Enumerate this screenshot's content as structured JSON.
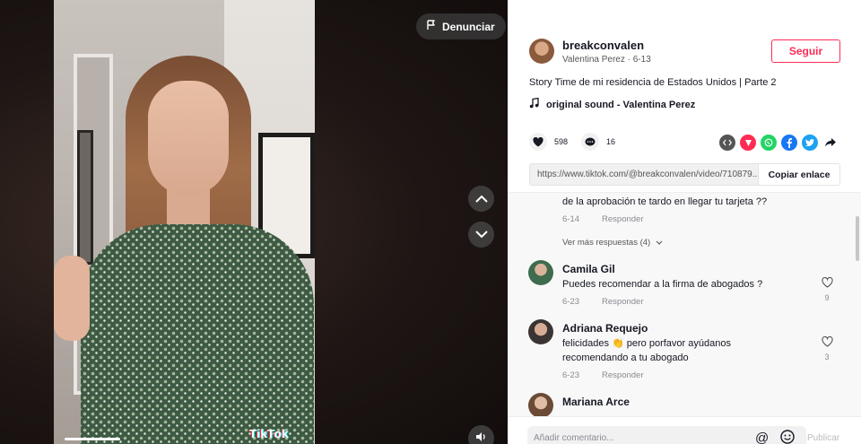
{
  "video": {
    "report_label": "Denunciar",
    "watermark": "TikTok"
  },
  "post": {
    "username": "breakconvalen",
    "display_name": "Valentina Perez",
    "date": "6-13",
    "separator": " · ",
    "follow_label": "Seguir",
    "description": "Story Time de mi residencia de Estados Unidos | Parte 2",
    "sound": "original sound - Valentina Perez",
    "likes": "598",
    "comments": "16",
    "link": "https://www.tiktok.com/@breakconvalen/video/710879...",
    "copy_label": "Copiar enlace"
  },
  "share_icons": [
    {
      "name": "embed-icon",
      "color": "#555555"
    },
    {
      "name": "friends-icon",
      "color": "#fe2c55"
    },
    {
      "name": "whatsapp-icon",
      "color": "#25d366"
    },
    {
      "name": "facebook-icon",
      "color": "#1877f2"
    },
    {
      "name": "twitter-icon",
      "color": "#1da1f2"
    },
    {
      "name": "share-arrow-icon",
      "color": "#161823"
    }
  ],
  "comments": {
    "partial": {
      "text": "de la aprobación te tardo en llegar tu tarjeta ??",
      "date": "6-14",
      "reply": "Responder"
    },
    "more_replies": "Ver más respuestas (4)",
    "items": [
      {
        "name": "Camila Gil",
        "text": "Puedes recomendar a la firma de abogados ?",
        "date": "6-23",
        "reply": "Responder",
        "likes": "9"
      },
      {
        "name": "Adriana Requejo",
        "text_line1": "felicidades 👏 pero porfavor ayúdanos",
        "text_line2": "recomendando a tu abogado",
        "date": "6-23",
        "reply": "Responder",
        "likes": "3"
      },
      {
        "name": "Mariana Arce"
      }
    ]
  },
  "composer": {
    "placeholder": "Añadir comentario...",
    "publish_label": "Publicar"
  }
}
